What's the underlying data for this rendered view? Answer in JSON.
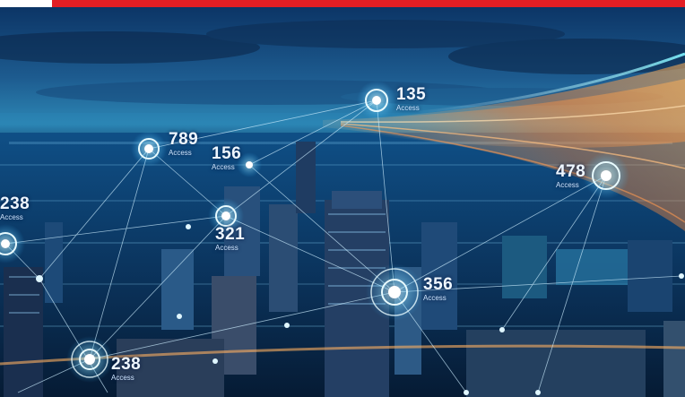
{
  "image": {
    "colors": {
      "accent_bar": "#e31e24",
      "sky_top": "#0b2a55",
      "city_glow": "#2fd0ff",
      "light_stream": "#ff9a3c"
    }
  },
  "nodes": [
    {
      "value": "135",
      "label": "Access"
    },
    {
      "value": "789",
      "label": "Access"
    },
    {
      "value": "156",
      "label": "Access"
    },
    {
      "value": "478",
      "label": "Access"
    },
    {
      "value": "238",
      "label": "Access"
    },
    {
      "value": "321",
      "label": "Access"
    },
    {
      "value": "356",
      "label": "Access"
    },
    {
      "value": "238",
      "label": "Access"
    }
  ]
}
